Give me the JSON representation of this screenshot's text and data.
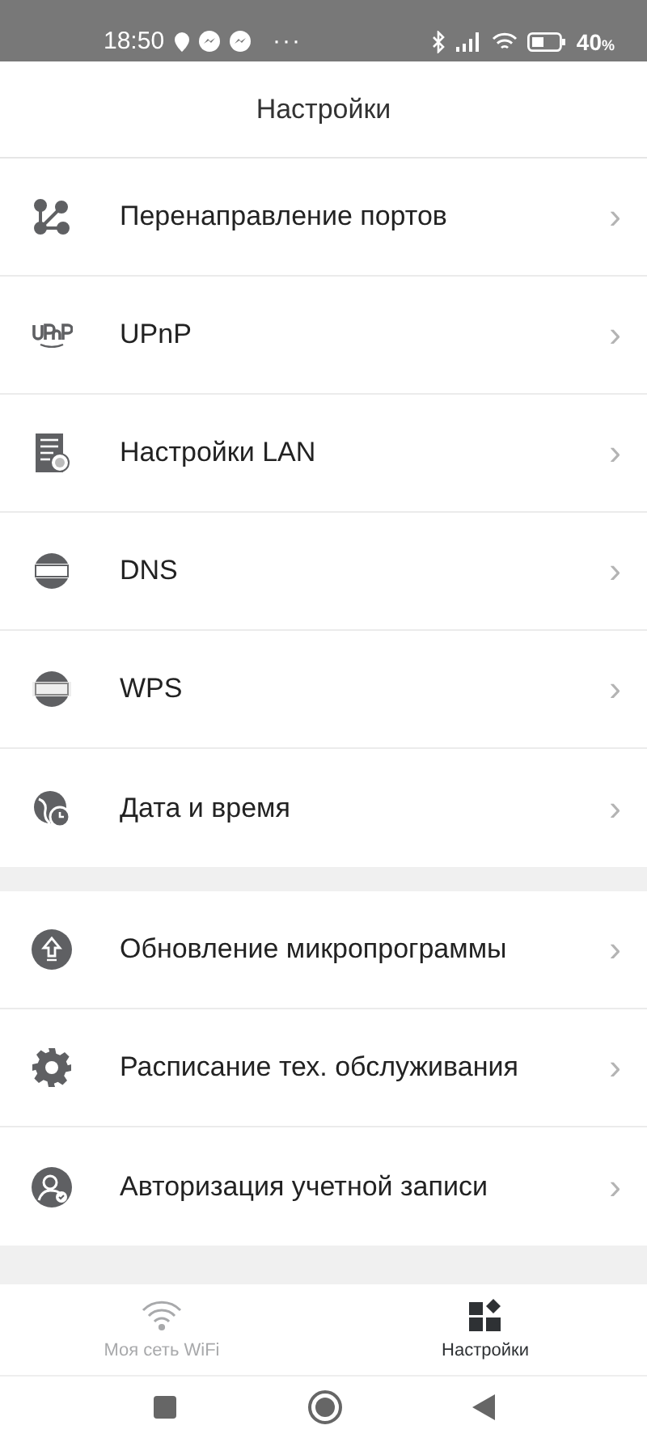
{
  "status_bar": {
    "time": "18:50",
    "more": "···",
    "battery": "40",
    "battery_unit": "%"
  },
  "header": {
    "title": "Настройки"
  },
  "groups": [
    {
      "items": [
        {
          "kind": "ports",
          "label": "Перенаправление портов",
          "chevron": "›"
        },
        {
          "kind": "upnp",
          "label": "UPnP",
          "chevron": "›"
        },
        {
          "kind": "lan",
          "label": "Настройки LAN",
          "chevron": "›"
        },
        {
          "kind": "dns",
          "label": "DNS",
          "chevron": "›"
        },
        {
          "kind": "wps",
          "label": "WPS",
          "chevron": "›"
        },
        {
          "kind": "datetime",
          "label": "Дата и время",
          "chevron": "›"
        }
      ]
    },
    {
      "items": [
        {
          "kind": "firmware",
          "label": "Обновление микропрограммы",
          "chevron": "›"
        },
        {
          "kind": "schedule",
          "label": "Расписание тех. обслуживания",
          "chevron": "›"
        },
        {
          "kind": "account",
          "label": "Авторизация учетной записи",
          "chevron": "›"
        }
      ]
    }
  ],
  "tabs": [
    {
      "kind": "wifi",
      "label": "Моя сеть WiFi",
      "selected": false
    },
    {
      "kind": "settings",
      "label": "Настройки",
      "selected": true
    }
  ]
}
